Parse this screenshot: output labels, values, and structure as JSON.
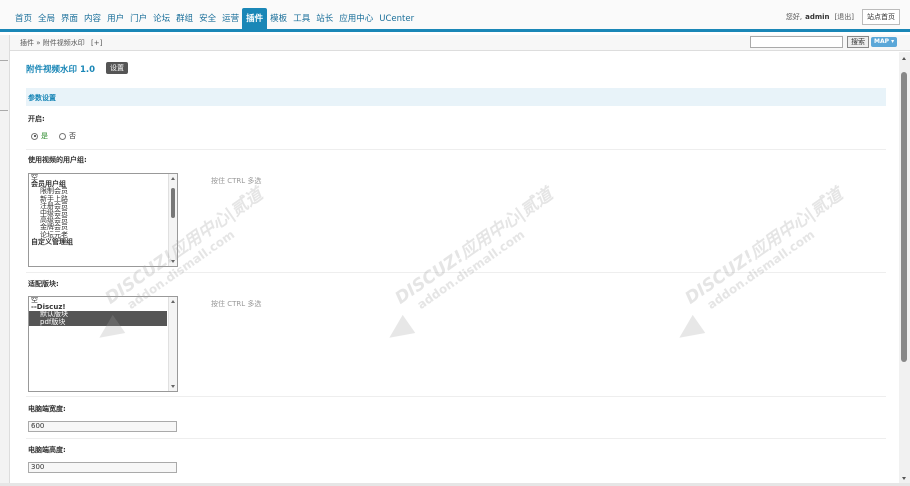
{
  "nav": {
    "items": [
      "首页",
      "全局",
      "界面",
      "内容",
      "用户",
      "门户",
      "论坛",
      "群组",
      "安全",
      "运营",
      "插件",
      "模板",
      "工具",
      "站长",
      "应用中心",
      "UCenter"
    ],
    "active": "插件"
  },
  "user": {
    "greeting": "您好,",
    "name": "admin",
    "logout": "[退出]",
    "site_home": "站点首页"
  },
  "breadcrumb": {
    "text": "插件 » 附件视频水印",
    "add": "[+]"
  },
  "search": {
    "value": "",
    "button": "搜索",
    "map": "MAP ▾"
  },
  "page": {
    "title": "附件视频水印 1.0",
    "settings_button": "设置",
    "section_title": "参数设置"
  },
  "fields": {
    "enable": {
      "label": "开启:",
      "yes": "是",
      "no": "否",
      "selected": "是"
    },
    "user_groups": {
      "label": "使用视频的用户组:",
      "hint": "按住 CTRL 多选",
      "options": [
        {
          "text": "空",
          "style": "plain"
        },
        {
          "text": "会员用户组",
          "style": "bold"
        },
        {
          "text": "限制会员",
          "style": "indent"
        },
        {
          "text": "新手上路",
          "style": "indent"
        },
        {
          "text": "注册会员",
          "style": "indent"
        },
        {
          "text": "中级会员",
          "style": "indent"
        },
        {
          "text": "高级会员",
          "style": "indent"
        },
        {
          "text": "金牌会员",
          "style": "indent"
        },
        {
          "text": "论坛元老",
          "style": "indent"
        },
        {
          "text": "自定义管理组",
          "style": "bold"
        }
      ]
    },
    "forums": {
      "label": "适配版块:",
      "hint": "按住 CTRL 多选",
      "options": [
        {
          "text": "空",
          "style": "plain"
        },
        {
          "text": "--Discuz!",
          "style": "bold"
        },
        {
          "text": "默认版块",
          "style": "selected"
        },
        {
          "text": "pdf版块",
          "style": "selected"
        }
      ]
    },
    "pc_width": {
      "label": "电脑端宽度:",
      "value": "600"
    },
    "pc_height": {
      "label": "电脑端高度:",
      "value": "300"
    }
  },
  "watermark": {
    "line1": "DISCUZ!应用中心|贰道",
    "line2": "addon.dismall.com"
  }
}
